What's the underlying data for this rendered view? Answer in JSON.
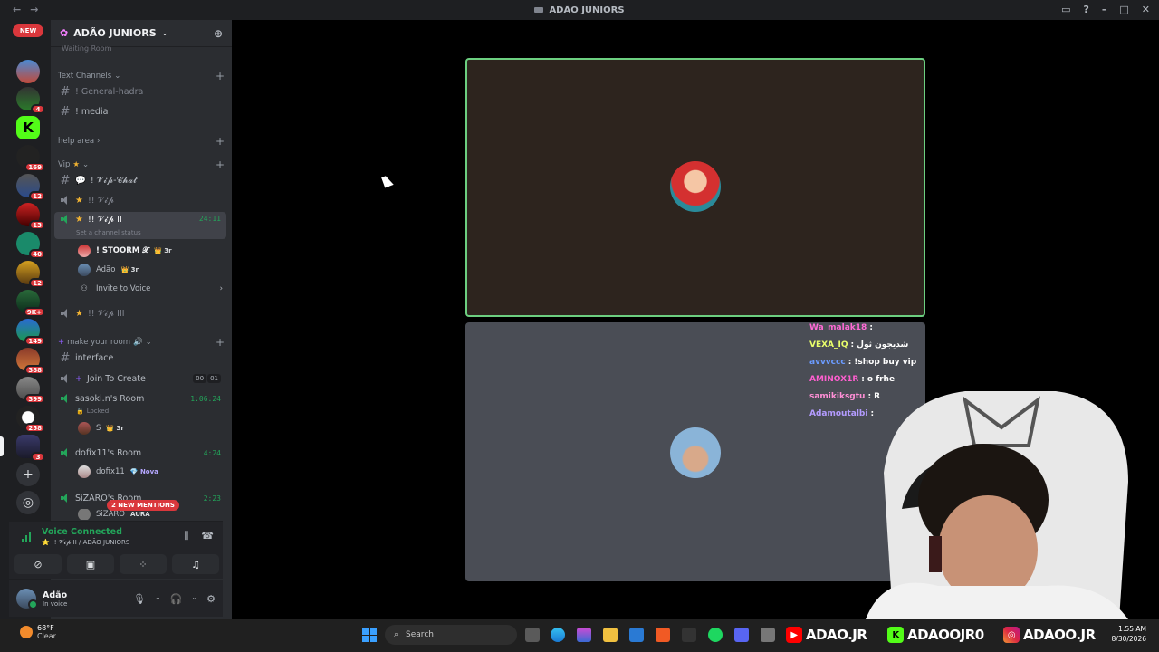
{
  "window": {
    "title": "ADÃO JUNIORS"
  },
  "rail": {
    "new_label": "NEW",
    "badges": [
      "4",
      "169",
      "12",
      "13",
      "40",
      "12",
      "9K+",
      "149",
      "388",
      "399",
      "258",
      "3"
    ]
  },
  "guild": {
    "name": "ADÃO JUNIORS",
    "waiting_room": "Waiting Room",
    "categories": {
      "text": "Text Channels",
      "help": "help area",
      "vip": "Vip",
      "make_room": "make your room"
    },
    "channels": {
      "general": "! General-hadra",
      "media": "! media",
      "vip_chat": "! 𝓥𝓲𝓹-𝓒𝓱𝓪𝓽",
      "vip": "!! 𝓥𝓲𝓹",
      "vip2": "!! 𝓥𝓲𝓹 II",
      "vip2_timer": "24:11",
      "vip2_status": "Set a channel status",
      "vip3": "!! 𝓥𝓲𝓹 III",
      "interface": "interface",
      "join_create": "Join To Create",
      "join_counts": [
        "00",
        "01"
      ],
      "sasoki": "sasoki.n's Room",
      "sasoki_timer": "1:06:24",
      "sasoki_status": "Locked",
      "dofix": "dofix11's Room",
      "dofix_timer": "4:24",
      "sizaro": "SiZARO's Room",
      "sizaro_timer": "2:23"
    },
    "voice_users": {
      "stoorm": "! STOORM 𝓧",
      "stoorm_tag": "👑 3r",
      "adao": "Adão",
      "adao_tag": "👑 3r",
      "invite": "Invite to Voice",
      "sasoki_user": "S",
      "sasoki_tag": "👑 3r",
      "dofix_user": "dofix11",
      "dofix_tag": "💎 Nova",
      "sizaro_user": "SiZARO",
      "sizaro_tag": "AURA"
    },
    "mention_pill": "2 NEW MENTIONS"
  },
  "voice_panel": {
    "status": "Voice Connected",
    "location": "⭐ !! 𝓥𝓲𝓹 II / ADÃO JUNIORS"
  },
  "user_panel": {
    "name": "Adão",
    "status": "In voice"
  },
  "chat": [
    {
      "user": "Wa_malak18",
      "msg": "",
      "color": "#ff6bd6"
    },
    {
      "user": "VEXA_IQ",
      "msg": "شديجون ثول",
      "color": "#e9ff6b"
    },
    {
      "user": "avvvccc",
      "msg": "!shop buy vip",
      "color": "#6b9bff"
    },
    {
      "user": "AMINOX1R",
      "msg": "o frhe",
      "color": "#ff5fd0"
    },
    {
      "user": "samikiksgtu",
      "msg": "R",
      "color": "#ff8fd6"
    },
    {
      "user": "Adamoutalbi",
      "msg": "",
      "color": "#b39bff"
    }
  ],
  "taskbar": {
    "temp": "68°F",
    "weather": "Clear",
    "search_placeholder": "Search",
    "socials": [
      "ADAO.JR",
      "ADAOOJR0",
      "ADAOO.JR"
    ],
    "time": "1:55 AM",
    "date": "8/30/2026"
  }
}
